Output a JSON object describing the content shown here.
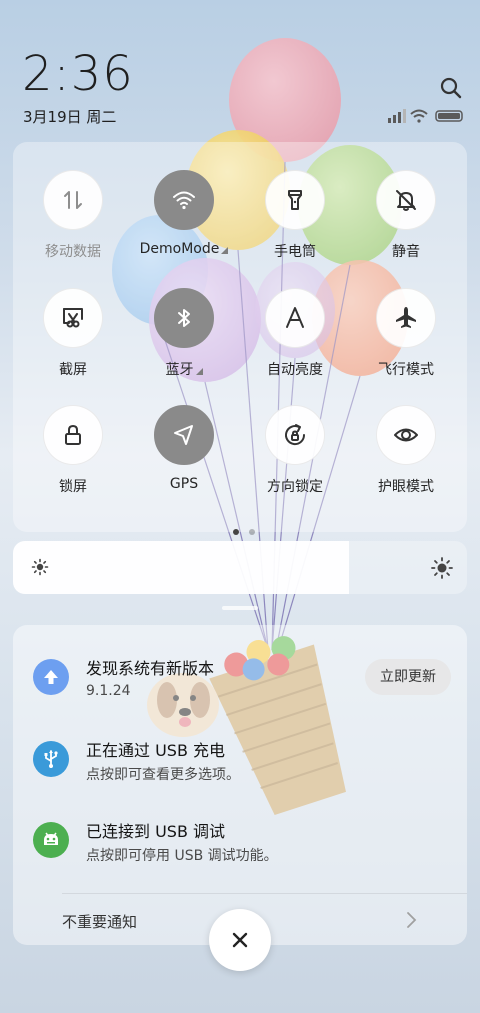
{
  "status": {
    "time": "2:36",
    "date": "3月19日 周二"
  },
  "quick_settings": {
    "tiles": [
      {
        "label": "移动数据",
        "icon": "mobile-data-icon",
        "active": false,
        "dim": true
      },
      {
        "label": "DemoMode",
        "icon": "wifi-icon",
        "active": true,
        "more": true
      },
      {
        "label": "手电筒",
        "icon": "flashlight-icon",
        "active": false
      },
      {
        "label": "静音",
        "icon": "mute-bell-icon",
        "active": false
      },
      {
        "label": "截屏",
        "icon": "screenshot-icon",
        "active": false
      },
      {
        "label": "蓝牙",
        "icon": "bluetooth-icon",
        "active": true,
        "more": true
      },
      {
        "label": "自动亮度",
        "icon": "auto-brightness-icon",
        "active": false
      },
      {
        "label": "飞行模式",
        "icon": "airplane-icon",
        "active": false
      },
      {
        "label": "锁屏",
        "icon": "lock-icon",
        "active": false
      },
      {
        "label": "GPS",
        "icon": "gps-icon",
        "active": true
      },
      {
        "label": "方向锁定",
        "icon": "rotation-lock-icon",
        "active": false
      },
      {
        "label": "护眼模式",
        "icon": "eye-icon",
        "active": false
      }
    ],
    "page_index": 0,
    "page_count": 2
  },
  "brightness": {
    "level": 0.74
  },
  "notifications": [
    {
      "title": "发现系统有新版本",
      "text": "9.1.24",
      "button": "立即更新",
      "icon": "update-arrow-icon",
      "color": "#6d9ff0"
    },
    {
      "title": "正在通过 USB 充电",
      "text": "点按即可查看更多选项。",
      "icon": "usb-icon",
      "color": "#3a9ad9"
    },
    {
      "title": "已连接到 USB 调试",
      "text": "点按即可停用 USB 调试功能。",
      "icon": "android-icon",
      "color": "#4caf50"
    }
  ],
  "footer": {
    "unimportant_label": "不重要通知"
  },
  "colors": {
    "active_tile": "#8a8a8a",
    "update_icon": "#6d9ff0",
    "usb_icon": "#3a9ad9",
    "android_icon": "#4caf50"
  }
}
